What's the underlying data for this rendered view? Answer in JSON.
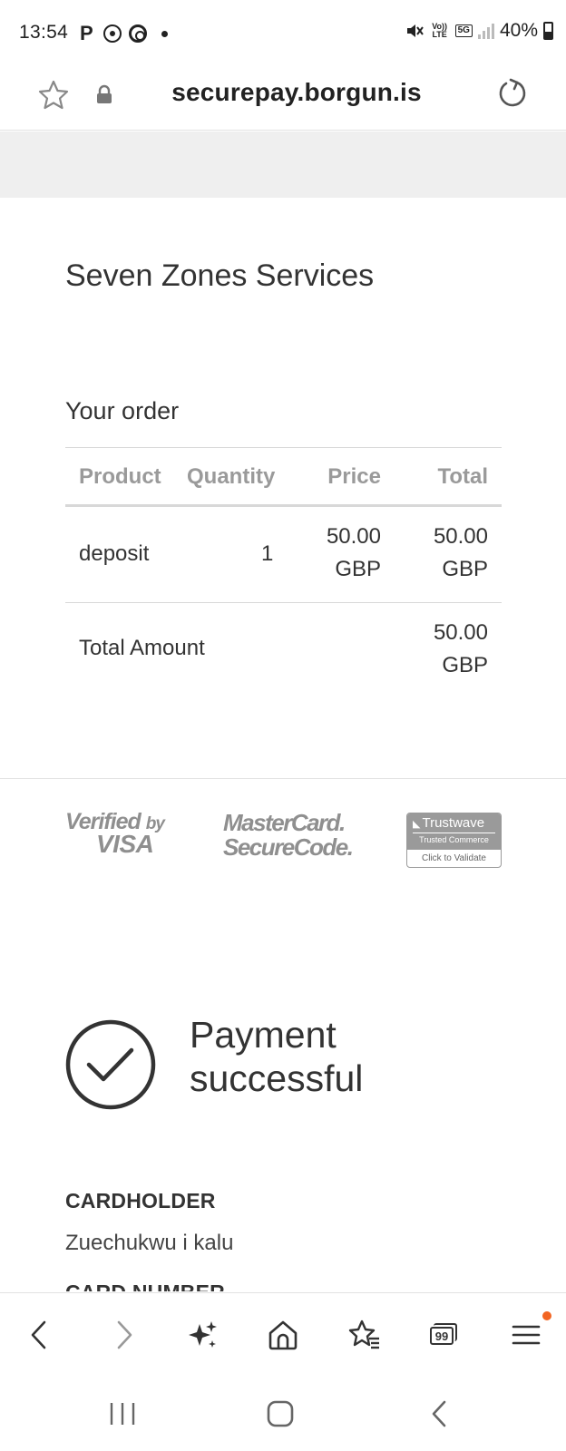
{
  "status_bar": {
    "time": "13:54",
    "battery": "40%",
    "network": "5G",
    "volte": "Vo)) LTE"
  },
  "browser": {
    "url": "securepay.borgun.is"
  },
  "merchant": {
    "name": "Seven Zones Services"
  },
  "order": {
    "heading": "Your order",
    "columns": [
      "Product",
      "Quantity",
      "Price",
      "Total"
    ],
    "items": [
      {
        "product": "deposit",
        "quantity": "1",
        "price": "50.00 GBP",
        "total": "50.00 GBP"
      }
    ],
    "total_label": "Total Amount",
    "total_value": "50.00 GBP"
  },
  "logos": {
    "visa_line1": "Verified",
    "visa_by": "by",
    "visa_line2": "VISA",
    "mastercard_line1": "MasterCard.",
    "mastercard_line2": "SecureCode.",
    "trustwave_brand": "Trustwave",
    "trustwave_sub": "Trusted Commerce",
    "trustwave_cta": "Click to Validate"
  },
  "payment": {
    "status": "Payment successful"
  },
  "card": {
    "cardholder_label": "CARDHOLDER",
    "cardholder_value": "Zuechukwu i kalu",
    "cardnumber_label": "CARD NUMBER"
  },
  "toolbar": {
    "tabs_count": "99"
  },
  "colors": {
    "notification_dot": "#f26522",
    "logo_grey": "#8f8f8f",
    "grey_band": "#efefef"
  }
}
